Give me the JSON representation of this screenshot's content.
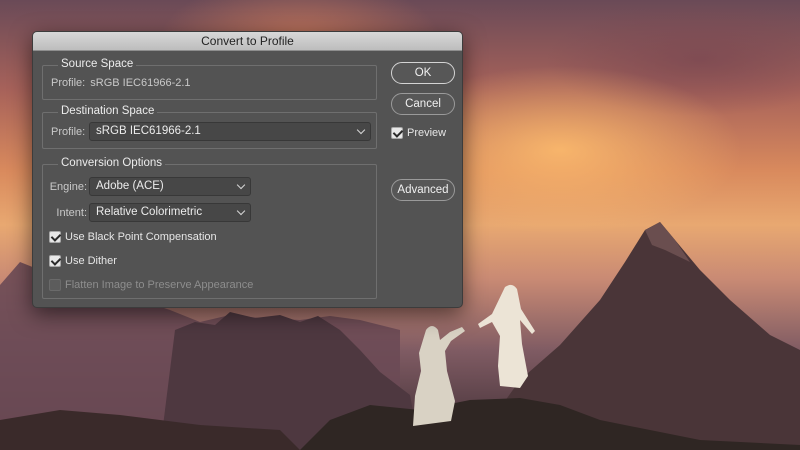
{
  "dialog": {
    "title": "Convert to Profile"
  },
  "source_space": {
    "title": "Source Space",
    "profile_label": "Profile:",
    "profile_value": "sRGB IEC61966-2.1"
  },
  "destination_space": {
    "title": "Destination Space",
    "profile_label": "Profile:",
    "profile_selected": "sRGB IEC61966-2.1"
  },
  "conversion_options": {
    "title": "Conversion Options",
    "engine_label": "Engine:",
    "engine_selected": "Adobe (ACE)",
    "intent_label": "Intent:",
    "intent_selected": "Relative Colorimetric",
    "black_point_label": "Use Black Point Compensation",
    "black_point_checked": true,
    "dither_label": "Use Dither",
    "dither_checked": true,
    "flatten_label": "Flatten Image to Preserve Appearance",
    "flatten_checked": false,
    "flatten_enabled": false
  },
  "buttons": {
    "ok": "OK",
    "cancel": "Cancel",
    "preview_label": "Preview",
    "preview_checked": true,
    "advanced": "Advanced"
  },
  "colors": {
    "dialog_bg": "#535353",
    "titlebar": "#c9c9c9",
    "field_bg": "#474747"
  }
}
